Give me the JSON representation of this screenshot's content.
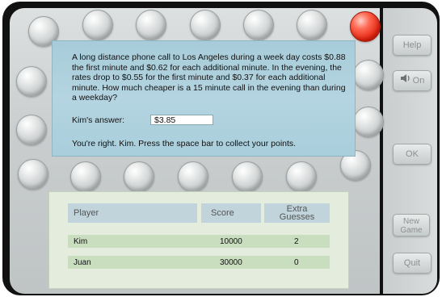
{
  "question": {
    "text": "A long distance phone call to Los Angeles during a week day costs $0.88 the first minute and $0.62 for each additional minute. In the evening, the rates drop to $0.55 for the first minute and $0.37 for each additional minute. How much cheaper is a 15 minute call in the evening than during a weekday?",
    "answer_label": "Kim's answer:",
    "answer_value": "$3.85",
    "feedback": "You're right. Kim. Press the space bar to collect your points."
  },
  "scoreboard": {
    "headers": {
      "player": "Player",
      "score": "Score",
      "extra_line1": "Extra",
      "extra_line2": "Guesses"
    },
    "rows": [
      {
        "player": "Kim",
        "score": "10000",
        "extra": "2"
      },
      {
        "player": "Juan",
        "score": "30000",
        "extra": "0"
      }
    ]
  },
  "buttons": {
    "help": "Help",
    "sound": "On",
    "ok": "OK",
    "new_game_line1": "New",
    "new_game_line2": "Game",
    "quit": "Quit"
  },
  "icons": {
    "sound": "speaker-icon"
  },
  "colors": {
    "active_bubble": "#e3220e",
    "question_bg": "#b4d4e1",
    "score_bg": "#e3ecdd"
  }
}
